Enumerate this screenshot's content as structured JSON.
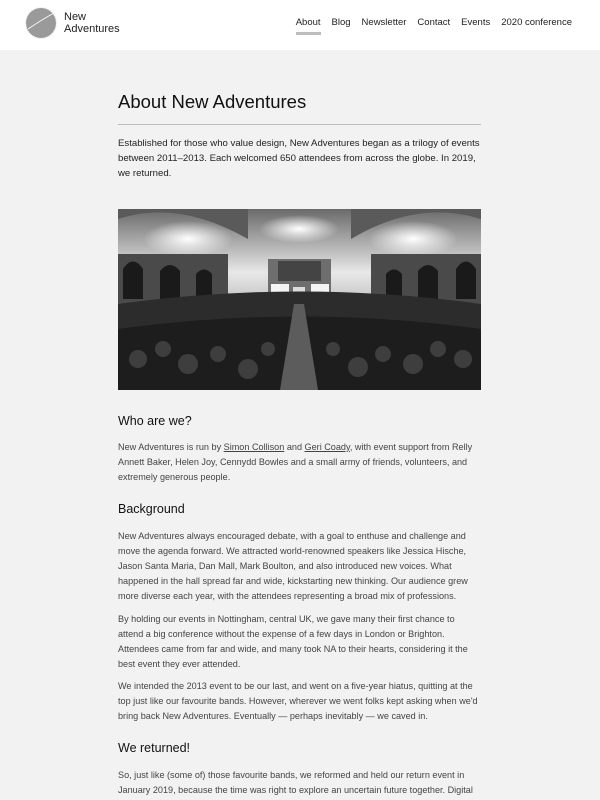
{
  "brand": {
    "line1": "New",
    "line2": "Adventures"
  },
  "nav": [
    "About",
    "Blog",
    "Newsletter",
    "Contact",
    "Events",
    "2020 conference"
  ],
  "page": {
    "title": "About New Adventures",
    "intro": "Established for those who value design, New Adventures began as a trilogy of events between 2011–2013. Each welcomed 650 attendees from across the globe. In 2019, we returned."
  },
  "who": {
    "heading": "Who are we?",
    "text_before": "New Adventures is run by ",
    "person1": "Simon Collison",
    "and": " and ",
    "person2": "Geri Coady",
    "text_after": ", with event support from Relly Annett Baker, Helen Joy, Cennydd Bowles and a small army of friends, volunteers, and extremely generous people."
  },
  "background": {
    "heading": "Background",
    "p1": "New Adventures always encouraged debate, with a goal to enthuse and challenge and move the agenda forward. We attracted world-renowned speakers like Jessica Hische, Jason Santa Maria, Dan Mall, Mark Boulton, and also introduced new voices. What happened in the hall spread far and wide, kickstarting new thinking. Our audience grew more diverse each year, with the attendees representing a broad mix of professions.",
    "p2": "By holding our events in Nottingham, central UK, we gave many their first chance to attend a big conference without the expense of a few days in London or Brighton. Attendees came from far and wide, and many took NA to their hearts, considering it the best event they ever attended.",
    "p3": "We intended the 2013 event to be our last, and went on a five-year hiatus, quitting at the top just like our favourite bands. However, wherever we went folks kept asking when we'd bring back New Adventures. Eventually — perhaps inevitably — we caved in."
  },
  "returned": {
    "heading": "We returned!",
    "p1": "So, just like (some of) those favourite bands, we reformed and held our return event in January 2019, because the time was right to explore an uncertain future together. Digital"
  }
}
